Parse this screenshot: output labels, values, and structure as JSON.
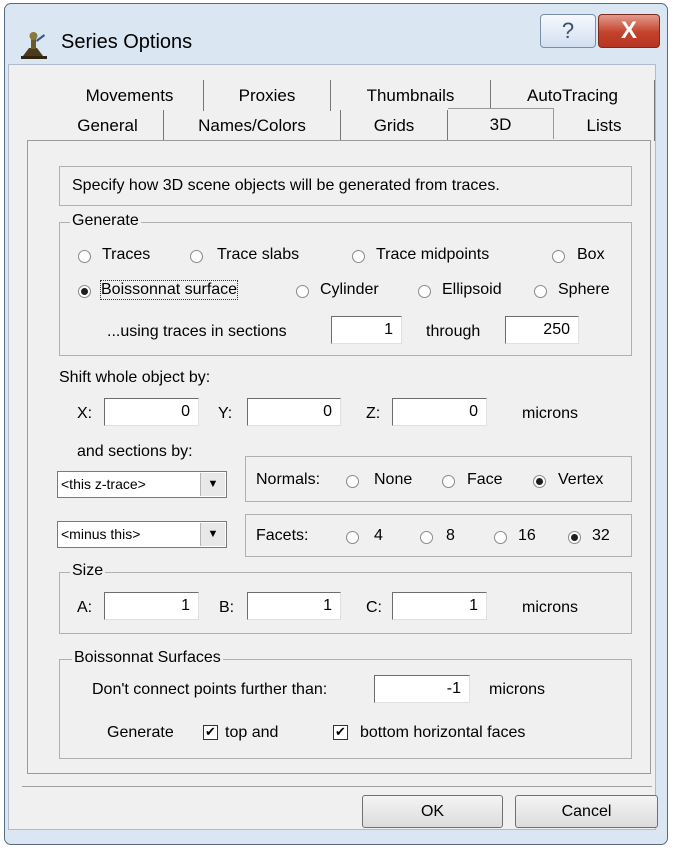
{
  "window": {
    "title": "Series Options",
    "help_glyph": "?",
    "close_glyph": "X"
  },
  "tabs": {
    "row1": [
      "Movements",
      "Proxies",
      "Thumbnails",
      "AutoTracing"
    ],
    "row2": [
      "General",
      "Names/Colors",
      "Grids",
      "3D",
      "Lists"
    ],
    "active": "3D"
  },
  "description": "Specify how 3D scene objects will be generated from traces.",
  "generate": {
    "legend": "Generate",
    "options": [
      "Traces",
      "Trace slabs",
      "Trace midpoints",
      "Box",
      "Boissonnat surface",
      "Cylinder",
      "Ellipsoid",
      "Sphere"
    ],
    "selected": "Boissonnat surface",
    "using_label": "...using traces in sections",
    "from": "1",
    "through_label": "through",
    "to": "250"
  },
  "shift": {
    "label": "Shift whole object by:",
    "x_label": "X:",
    "x": "0",
    "y_label": "Y:",
    "y": "0",
    "z_label": "Z:",
    "z": "0",
    "units": "microns",
    "sections_label": "and sections by:",
    "combo1": "<this z-trace>",
    "combo2": "<minus this>"
  },
  "normals": {
    "label": "Normals:",
    "options": [
      "None",
      "Face",
      "Vertex"
    ],
    "selected": "Vertex"
  },
  "facets": {
    "label": "Facets:",
    "options": [
      "4",
      "8",
      "16",
      "32"
    ],
    "selected": "32"
  },
  "size": {
    "legend": "Size",
    "a_label": "A:",
    "a": "1",
    "b_label": "B:",
    "b": "1",
    "c_label": "C:",
    "c": "1",
    "units": "microns"
  },
  "boissonnat": {
    "legend": "Boissonnat Surfaces",
    "connect_label": "Don't connect points further than:",
    "distance": "-1",
    "units": "microns",
    "generate_label": "Generate",
    "top_label": "top and",
    "top_checked": true,
    "bottom_label": "bottom horizontal faces",
    "bottom_checked": true
  },
  "buttons": {
    "ok": "OK",
    "cancel": "Cancel"
  },
  "icons": {
    "app": "app-icon",
    "combo_arrow": "dropdown-arrow-icon",
    "check_glyph": "✔"
  }
}
